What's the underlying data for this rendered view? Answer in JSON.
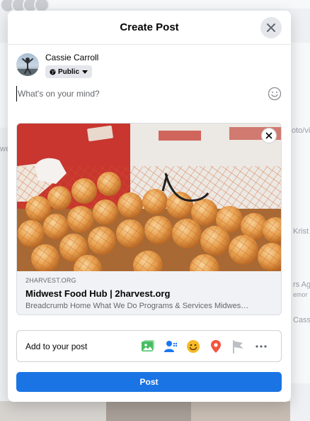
{
  "modal": {
    "title": "Create Post"
  },
  "user": {
    "name": "Cassie Carroll",
    "privacy_label": "Public"
  },
  "composer": {
    "placeholder": "What's on your mind?"
  },
  "link_preview": {
    "domain": "2HARVEST.ORG",
    "title": "Midwest Food Hub | 2harvest.org",
    "description": "Breadcrumb Home What We Do Programs & Services Midwes…"
  },
  "add_to_post": {
    "label": "Add to your post",
    "icons": [
      "photo-video-icon",
      "tag-people-icon",
      "feeling-activity-icon",
      "check-in-icon",
      "life-event-flag-icon",
      "more-icon"
    ]
  },
  "actions": {
    "post_label": "Post"
  },
  "background": {
    "fragments": [
      "oto/vi",
      "we",
      "Krist",
      "rs Ag",
      "emor",
      "Cassi"
    ]
  },
  "colors": {
    "accent": "#1b74e4",
    "photo_icon": "#45bd62",
    "tag_icon": "#1877f2",
    "feeling_icon": "#f7b928",
    "checkin_icon": "#f5533d",
    "flag_icon": "#bcc0c4"
  }
}
